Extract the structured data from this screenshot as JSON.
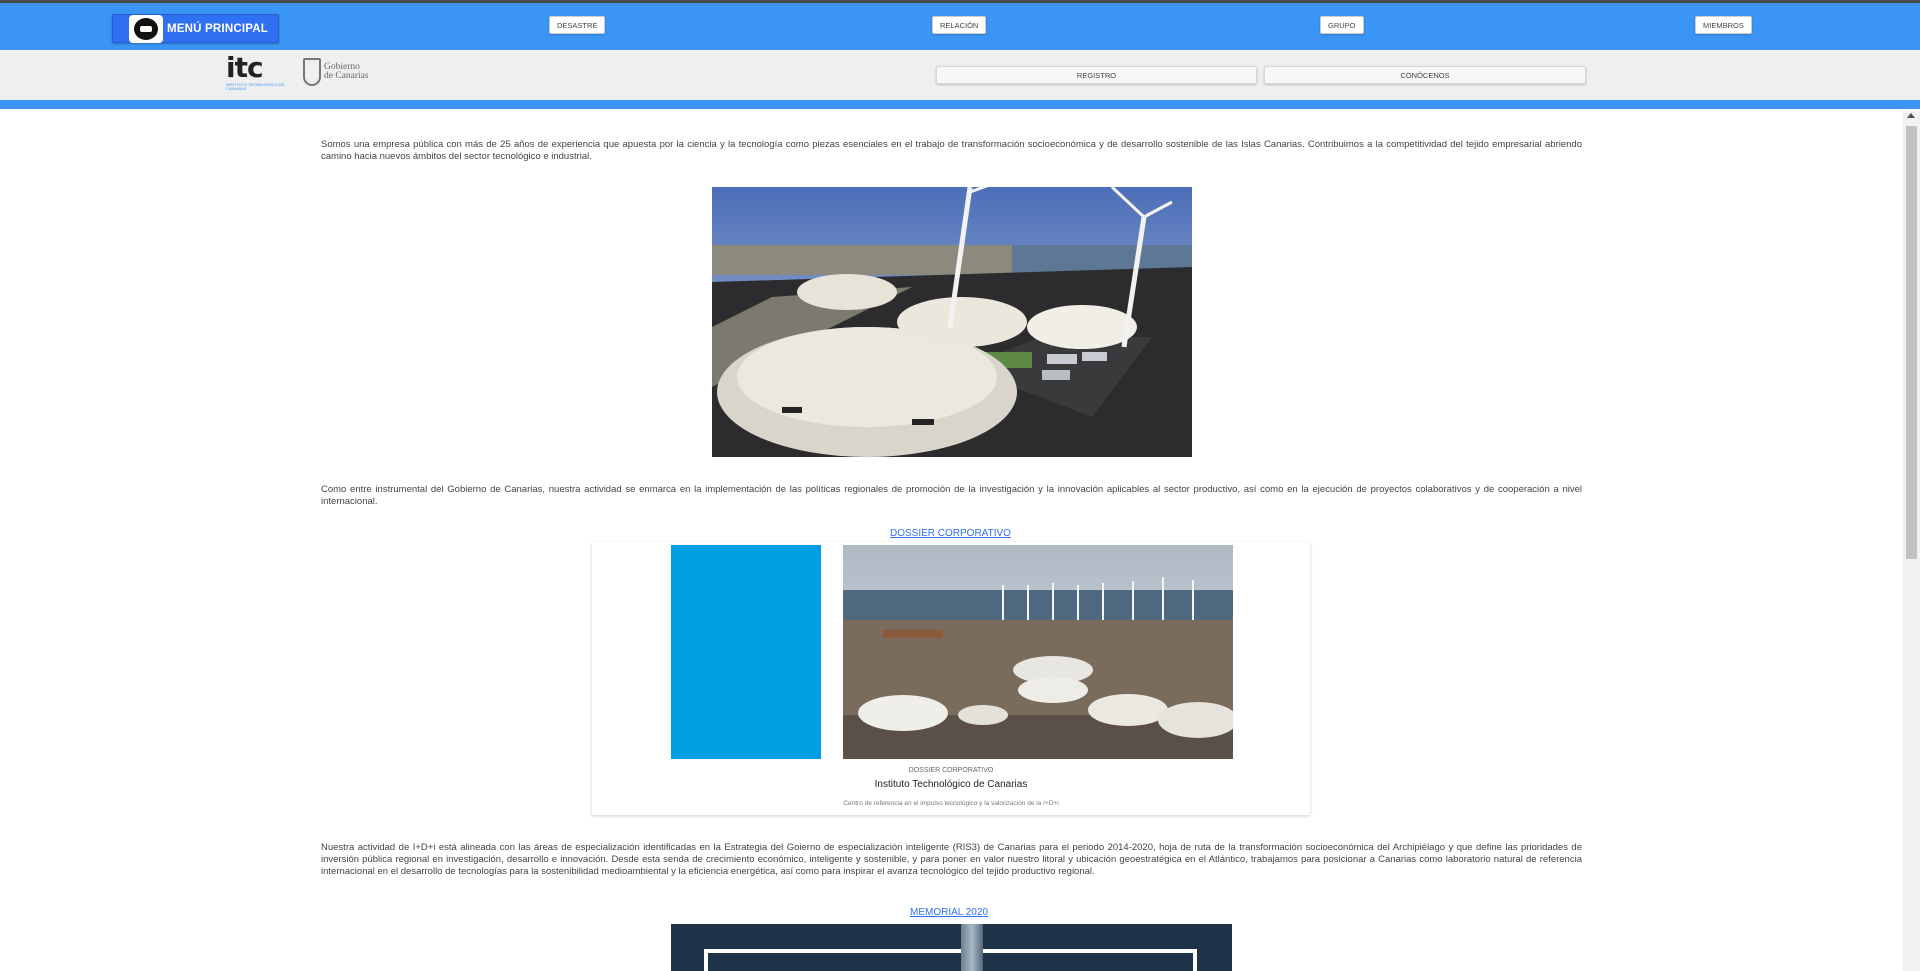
{
  "topnav": {
    "menu_label": "MENÚ PRINCIPAL",
    "items": [
      {
        "label": "DESASTRE"
      },
      {
        "label": "RELACIÓN"
      },
      {
        "label": "GRUPO"
      },
      {
        "label": "MIEMBROS"
      }
    ]
  },
  "subnav": {
    "itc_logo_text": "itc",
    "itc_logo_sub": "INSTITUTO TECNOLÓGICO DE CANARIAS",
    "gob_logo_line1": "Gobierno",
    "gob_logo_line2": "de Canarias",
    "buttons": [
      {
        "label": "REGISTRO"
      },
      {
        "label": "CONÓCENOS"
      }
    ]
  },
  "content": {
    "para1": "Somos una empresa pública con más de 25 años de experiencia que apuesta por la ciencia y la tecnología como piezas esenciales en el trabajo de transformación socioeconómica y de desarrollo sostenible de las Islas Canarias. Contribuimos a la competitividad del tejido empresarial abriendo camino hacia nuevos ámbitos del sector tecnológico e industrial.",
    "para2": "Como entre instrumental del Gobierno de Canarias, nuestra actividad se enmarca en la implementación de las políticas regionales de promoción de la investigación y la innovación aplicables al sector productivo, así como en la ejecución de proyectos colaborativos y de cooperación a nivel internacional.",
    "dossier_link": "DOSSIER CORPORATIVO",
    "card": {
      "kicker": "DOSSIER CORPORATIVO",
      "title": "Instituto Technológico de Canarias",
      "description": "Centro de referencia en el impulso tecnológico y la valorización de la I+D+i"
    },
    "para3": "Nuestra actividad de I+D+i está alineada con las áreas de especialización identificadas en la Estrategia del Goierno de especialización inteligente (RIS3) de Canarias para el periodo 2014-2020, hoja de ruta de la transformación socioeconómica del Archipiélago y que define las prioridades de inversión pública regional en investigación, desarrollo e innovación. Desde esta senda de crecimiento económico, inteligente y sostenible, y para poner en valor nuestro litoral y ubicación geoestratégica en el Atlántico, trabajamos para posicionar a Canarias como laboratorio natural de referencia internacional en el desarrollo de tecnologías para la sostenibilidad medioambiental y la eficiencia energética, así como para inspirar el avanza tecnológico del tejido productivo regional.",
    "memorial_link": "MEMORIAL 2020"
  },
  "colors": {
    "nav_blue": "#3a95f5",
    "menu_button": "#2f6ff2",
    "card_blue": "#009fe3",
    "link": "#2f6ff2"
  }
}
